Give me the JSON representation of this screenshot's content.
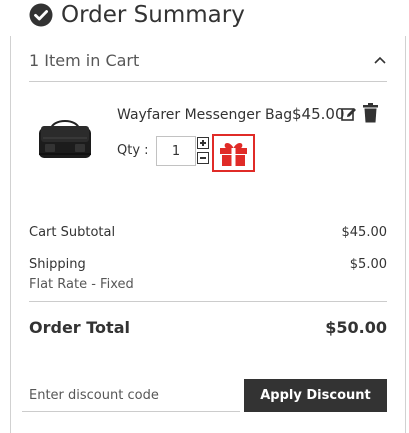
{
  "header": {
    "title": "Order Summary",
    "icon": "check-circle-icon"
  },
  "cart": {
    "count_label": "1 Item in Cart",
    "expanded": true
  },
  "item": {
    "name": "Wayfarer Messenger Bag",
    "price": "$45.00",
    "qty_label": "Qty :",
    "qty_value": "1",
    "image": "messenger-bag-photo"
  },
  "totals": {
    "subtotal_label": "Cart Subtotal",
    "subtotal_value": "$45.00",
    "shipping_label": "Shipping",
    "shipping_method": "Flat Rate - Fixed",
    "shipping_value": "$5.00",
    "order_total_label": "Order Total",
    "order_total_value": "$50.00"
  },
  "discount": {
    "placeholder": "Enter discount code",
    "button_label": "Apply Discount"
  },
  "colors": {
    "gift_accent": "#e02b27",
    "button_bg": "#333333",
    "text": "#333333"
  }
}
